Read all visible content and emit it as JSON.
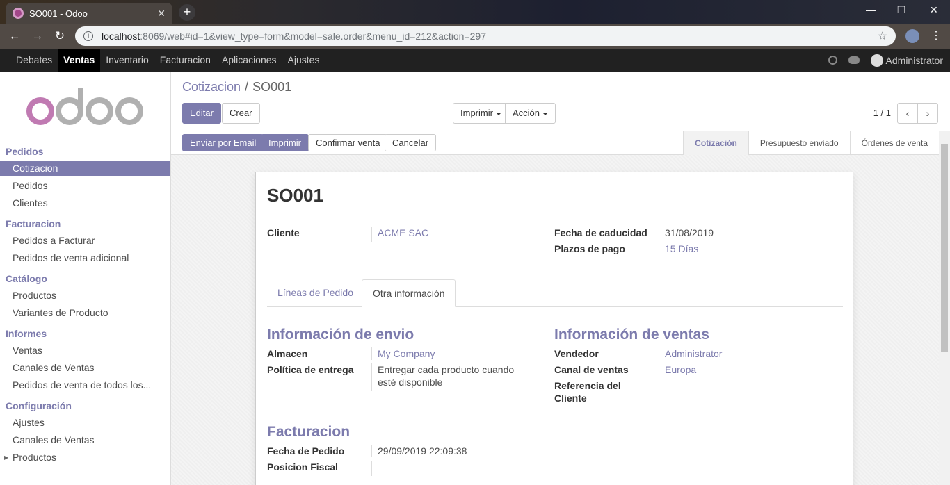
{
  "browser": {
    "tab_title": "SO001 - Odoo",
    "tab_close": "✕",
    "new_tab": "+",
    "url_host": "localhost",
    "url_rest": ":8069/web#id=1&view_type=form&model=sale.order&menu_id=212&action=297",
    "win_min": "—",
    "win_restore": "❐",
    "win_close": "✕"
  },
  "topmenu": {
    "items": [
      "Debates",
      "Ventas",
      "Inventario",
      "Facturacion",
      "Aplicaciones",
      "Ajustes"
    ],
    "active": "Ventas",
    "user": "Administrator"
  },
  "sidebar": {
    "sections": [
      {
        "title": "Pedidos",
        "items": [
          "Cotizacion",
          "Pedidos",
          "Clientes"
        ]
      },
      {
        "title": "Facturacion",
        "items": [
          "Pedidos a Facturar",
          "Pedidos de venta adicional"
        ]
      },
      {
        "title": "Catálogo",
        "items": [
          "Productos",
          "Variantes de Producto"
        ]
      },
      {
        "title": "Informes",
        "items": [
          "Ventas",
          "Canales de Ventas",
          "Pedidos de venta de todos los..."
        ]
      },
      {
        "title": "Configuración",
        "items": [
          "Ajustes",
          "Canales de Ventas",
          "Productos"
        ]
      }
    ],
    "active_item": "Cotizacion"
  },
  "control_panel": {
    "breadcrumb_parent": "Cotizacion",
    "breadcrumb_sep": "/",
    "breadcrumb_current": "SO001",
    "edit_label": "Editar",
    "create_label": "Crear",
    "print_label": "Imprimir",
    "action_label": "Acción",
    "pager": "1 / 1",
    "prev": "‹",
    "next": "›"
  },
  "statusbar": {
    "buttons": {
      "email": "Enviar por Email",
      "print": "Imprimir",
      "confirm": "Confirmar venta",
      "cancel": "Cancelar"
    },
    "steps": [
      "Cotización",
      "Presupuesto enviado",
      "Órdenes de venta"
    ],
    "current_step": "Cotización"
  },
  "form": {
    "name": "SO001",
    "cliente_label": "Cliente",
    "cliente_value": "ACME SAC",
    "caducidad_label": "Fecha de caducidad",
    "caducidad_value": "31/08/2019",
    "plazos_label": "Plazos de pago",
    "plazos_value": "15 Días",
    "tabs": [
      "Líneas de Pedido",
      "Otra información"
    ],
    "active_tab": "Otra información",
    "envio_title": "Información de envio",
    "almacen_label": "Almacen",
    "almacen_value": "My Company",
    "politica_label": "Política de entrega",
    "politica_value": "Entregar cada producto cuando esté disponible",
    "ventas_title": "Información de ventas",
    "vendedor_label": "Vendedor",
    "vendedor_value": "Administrator",
    "canal_label": "Canal de ventas",
    "canal_value": "Europa",
    "referencia_label": "Referencia del Cliente",
    "facturacion_title": "Facturacion",
    "fecha_pedido_label": "Fecha de Pedido",
    "fecha_pedido_value": "29/09/2019 22:09:38",
    "posicion_label": "Posicion Fiscal"
  },
  "colors": {
    "accent": "#7c7bad",
    "topbar": "#212121",
    "logo_pink": "#c07ab2",
    "logo_gray": "#b0b0b0"
  }
}
